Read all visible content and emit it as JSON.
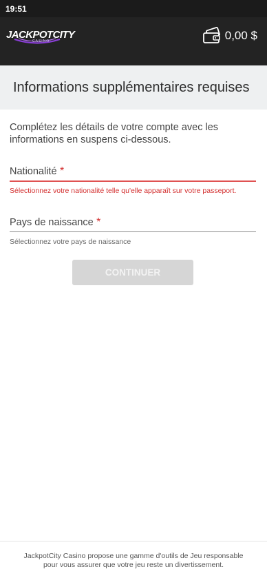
{
  "status_bar": {
    "time": "19:51"
  },
  "header": {
    "logo_text": "JACKPOTCITY",
    "logo_subtext": "CASINO",
    "balance": "0,00 $",
    "wallet_icon": "wallet-icon"
  },
  "page": {
    "title": "Informations supplémentaires requises"
  },
  "intro": "Complétez les détails de votre compte avec les informations en suspens ci-dessous.",
  "fields": [
    {
      "label": "Nationalité",
      "required_mark": "*",
      "helper": "Sélectionnez votre nationalité telle qu'elle apparaît sur votre passeport.",
      "state": "error"
    },
    {
      "label": "Pays de naissance",
      "required_mark": "*",
      "helper": "Sélectionnez votre pays de naissance",
      "state": "normal"
    }
  ],
  "continue_label": "CONTINUER",
  "footer": {
    "line1": "JackpotCity Casino propose une gamme d'outils de Jeu responsable",
    "line2": "pour vous assurer que votre jeu reste un divertissement."
  },
  "colors": {
    "header_bg": "#232323",
    "error": "#d32f2f",
    "title_bar_bg": "#eef0f1",
    "button_disabled": "#d6d6d6"
  }
}
